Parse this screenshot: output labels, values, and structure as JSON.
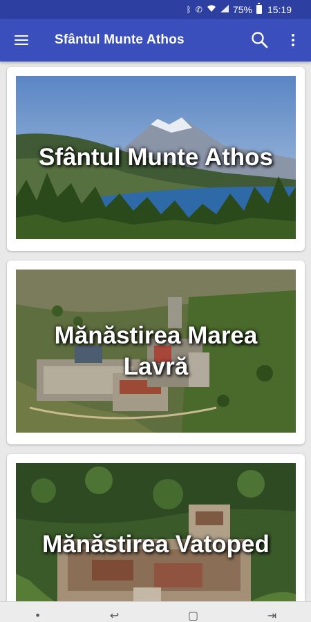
{
  "status_bar": {
    "icons": [
      "bluetooth-icon",
      "call-icon",
      "wifi-icon",
      "signal-icon"
    ],
    "battery": "75%",
    "time": "15:19"
  },
  "app_bar": {
    "title": "Sfântul Munte Athos",
    "menu_icon": "hamburger-menu-icon",
    "search_icon": "search-icon",
    "overflow_icon": "more-vert-icon"
  },
  "cards": [
    {
      "title": "Sfântul Munte Athos"
    },
    {
      "title": "Mănăstirea Marea Lavră"
    },
    {
      "title": "Mănăstirea Vatoped"
    }
  ],
  "nav_bar": {
    "icons": [
      "dot-icon",
      "back-icon",
      "home-icon",
      "recents-icon"
    ]
  },
  "colors": {
    "status_bar": "#2d3fa0",
    "app_bar": "#3a4fbb",
    "background": "#e9e9e9"
  }
}
